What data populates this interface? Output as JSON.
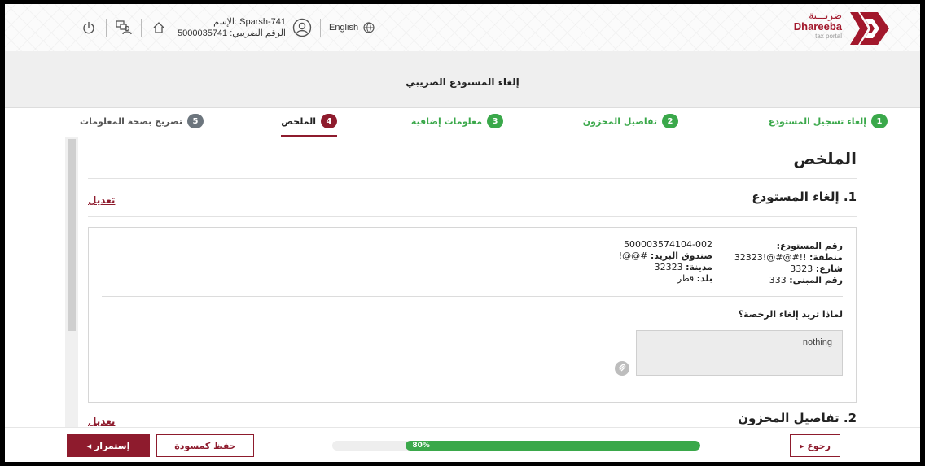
{
  "header": {
    "logo": {
      "arabic": "ضريـــبة",
      "english": "Dhareeba",
      "sub": "tax portal"
    },
    "user": {
      "name": "الإسم: Sparsh-741",
      "tax_no": "الرقم الضريبي: 5000035741"
    },
    "language": "English",
    "icons": [
      "power-icon",
      "switch-account-icon",
      "home-icon",
      "user-circle-icon",
      "globe-icon"
    ]
  },
  "page_title": "إلغاء المستودع الضريبي",
  "steps": [
    {
      "num": "1",
      "label": "إلغاء تسجيل المستودع",
      "state": "done"
    },
    {
      "num": "2",
      "label": "تفاصيل المخزون",
      "state": "done"
    },
    {
      "num": "3",
      "label": "معلومات إضافية",
      "state": "done"
    },
    {
      "num": "4",
      "label": "الملخص",
      "state": "active"
    },
    {
      "num": "5",
      "label": "تصريح بصحة المعلومات",
      "state": "pending"
    }
  ],
  "summary": {
    "heading": "الملخص",
    "section1": {
      "title": "1. إلغاء المستودع",
      "edit": "تعديل",
      "fields": {
        "warehouse_no_label": "رقم المستودع:",
        "warehouse_no": "500003574104-002",
        "zone_label": "منطقة:",
        "zone": "!!#@#@!32323",
        "po_box_label": "صندوق البريد:",
        "po_box": "#@@!",
        "street_label": "شارع:",
        "street": "3323",
        "city_label": "مدينة:",
        "city": "32323",
        "building_label": "رقم المبنى:",
        "building": "333",
        "country_label": "بلد:",
        "country": "قطر"
      },
      "question": "لماذا تريد إلغاء الرخصة؟",
      "answer": "nothing"
    },
    "section2": {
      "title": "2. تفاصيل المخزون",
      "edit": "تعديل"
    }
  },
  "footer": {
    "back": "رجوع ▸",
    "save_draft": "حفظ كمسودة",
    "continue": "إستمرار ◂",
    "progress_label": "80%",
    "progress_value": 0.8
  },
  "colors": {
    "brand": "#8e1b2d",
    "success": "#3aa84a"
  }
}
